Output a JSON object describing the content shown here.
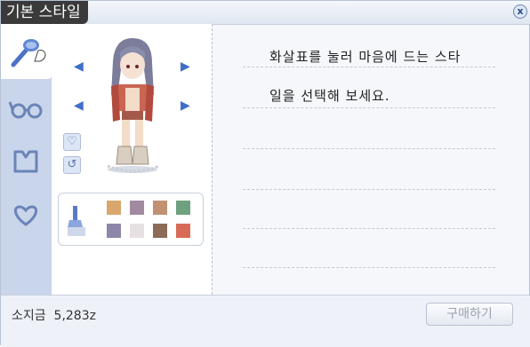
{
  "window": {
    "title": "기본 스타일",
    "close_label": "x"
  },
  "sidebar": {
    "tabs": [
      {
        "name": "hairstyle",
        "icon": "comb-icon"
      },
      {
        "name": "glasses",
        "icon": "glasses-icon"
      },
      {
        "name": "clothes",
        "icon": "shirt-icon"
      },
      {
        "name": "favorite",
        "icon": "heart-icon"
      }
    ]
  },
  "preview": {
    "small_buttons": [
      {
        "icon": "heart-icon",
        "glyph": "♡"
      },
      {
        "icon": "reset-icon",
        "glyph": "↺"
      }
    ]
  },
  "palette": {
    "colors": [
      "#d9a66e",
      "#a18aa0",
      "#c29174",
      "#6ea17f",
      "#8e86a8",
      "#e7e0e3",
      "#8c6a58",
      "#d86b58"
    ]
  },
  "message": {
    "line1": "화살표를 눌러 마음에 드는 스타",
    "line2": "일을 선택해 보세요."
  },
  "footer": {
    "money_label": "소지금",
    "money_value": "5,283z",
    "buy_label": "구매하기"
  }
}
